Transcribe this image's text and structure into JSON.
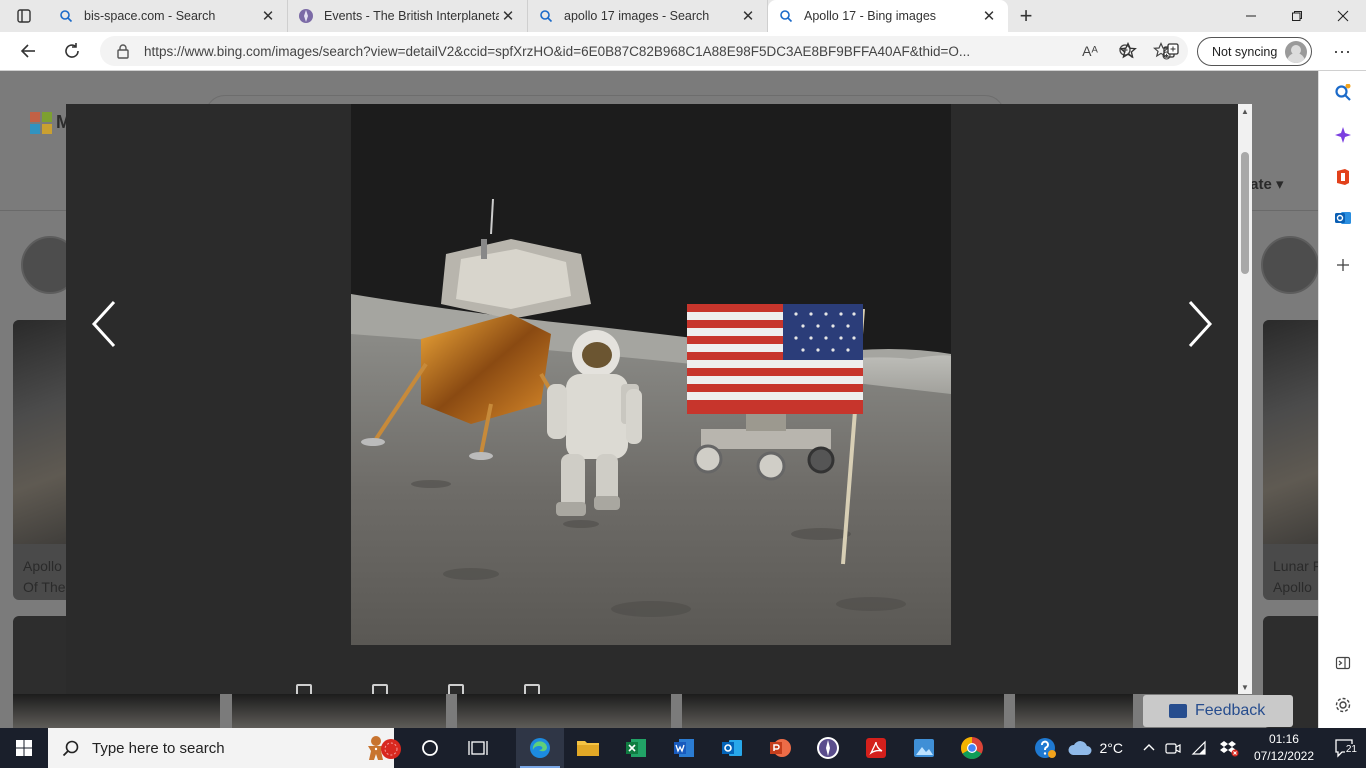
{
  "browser": {
    "tabs": [
      {
        "title": "bis-space.com - Search",
        "active": false,
        "favicon": "search-icon"
      },
      {
        "title": "Events - The British Interplanetar",
        "active": false,
        "favicon": "bis-logo-icon"
      },
      {
        "title": "apollo 17 images - Search",
        "active": false,
        "favicon": "search-icon"
      },
      {
        "title": "Apollo 17 - Bing images",
        "active": true,
        "favicon": "search-icon"
      }
    ],
    "new_tab_label": "+",
    "address": {
      "url": "https://www.bing.com/images/search?view=detailV2&ccid=spfXrzHO&id=6E0B87C82B968C1A88E98F5DC3AE8BF9BFFA40AF&thid=O...",
      "read_aloud_label": "Aᴬ"
    },
    "profile": {
      "label": "Not syncing"
    },
    "more_label": "···"
  },
  "page": {
    "brand_partial": "M",
    "generate_partial": "erate",
    "captions": [
      {
        "line1": "Apollo",
        "line2": "Of The"
      },
      {
        "line1": "Lunar F",
        "line2": "Apollo"
      }
    ],
    "feedback_label": "Feedback"
  },
  "modal": {
    "prev_label": "‹",
    "next_label": "›",
    "image": {
      "subject": "apollo-17-astronaut-flag-lunar-module-rover"
    }
  },
  "taskbar": {
    "search_placeholder": "Type here to search",
    "weather": "2°C",
    "time": "01:16",
    "date": "07/12/2022",
    "notifications": "21"
  },
  "colors": {
    "accent": "#0067c0",
    "modal_bg": "#2b2b2b",
    "taskbar_bg": "#1a1f2b",
    "feedback_text": "#274d8e"
  }
}
